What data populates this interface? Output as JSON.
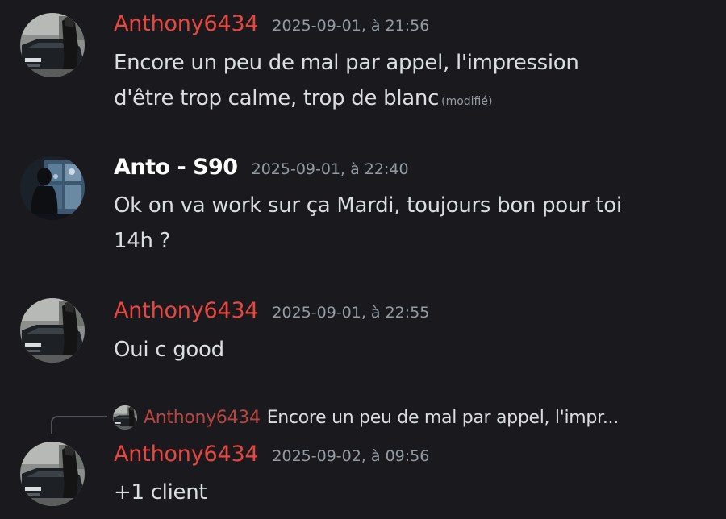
{
  "colors": {
    "background": "#1a1a1e",
    "username_anthony": "#e8473f",
    "username_anto": "#ffffff",
    "reply_user": "#b8463e",
    "text": "#dbdee1",
    "muted": "#949ba4"
  },
  "messages": [
    {
      "username": "Anthony6434",
      "timestamp": "2025-09-01, à 21:56",
      "lines": [
        "Encore un peu de mal par appel, l'impression",
        "d'être trop calme, trop de blanc"
      ],
      "edited": "(modifié)",
      "avatar_icon": "car-avatar-icon"
    },
    {
      "username": "Anto - S90",
      "timestamp": "2025-09-01, à 22:40",
      "lines": [
        "Ok on va work sur ça Mardi, toujours bon pour toi",
        "14h ?"
      ],
      "avatar_icon": "window-silhouette-avatar-icon"
    },
    {
      "username": "Anthony6434",
      "timestamp": "2025-09-01, à 22:55",
      "lines": [
        "Oui c good"
      ],
      "avatar_icon": "car-avatar-icon"
    },
    {
      "username": "Anthony6434",
      "timestamp": "2025-09-02, à 09:56",
      "lines": [
        "+1 client"
      ],
      "avatar_icon": "car-avatar-icon",
      "reply": {
        "username": "Anthony6434",
        "text": "Encore un peu de mal par appel, l'impr..."
      }
    }
  ]
}
